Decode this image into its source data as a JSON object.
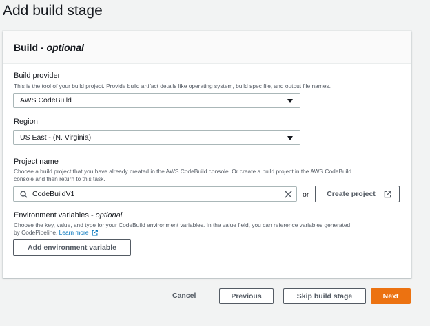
{
  "page": {
    "title": "Add build stage"
  },
  "panel": {
    "title": "Build",
    "title_suffix": "optional",
    "build_provider": {
      "label": "Build provider",
      "description": "This is the tool of your build project. Provide build artifact details like operating system, build spec file, and output file names.",
      "value": "AWS CodeBuild"
    },
    "region": {
      "label": "Region",
      "value": "US East - (N. Virginia)"
    },
    "project_name": {
      "label": "Project name",
      "description_line1": "Choose a build project that you have already created in the AWS CodeBuild console. Or create a build project in the AWS CodeBuild",
      "description_line2": "console and then return to this task.",
      "value": "CodeBuildV1",
      "or_text": "or",
      "create_button": "Create project"
    },
    "env_vars": {
      "label": "Environment variables",
      "label_suffix": "optional",
      "description_line1": "Choose the key, value, and type for your CodeBuild environment variables. In the value field, you can reference variables generated",
      "description_line2": "by CodePipeline.",
      "learn_more": "Learn more",
      "add_button": "Add environment variable"
    }
  },
  "footer": {
    "cancel": "Cancel",
    "previous": "Previous",
    "skip": "Skip build stage",
    "next": "Next"
  },
  "colors": {
    "primary": "#ec7211",
    "link": "#0073bb",
    "background": "#f2f3f3"
  },
  "icons": [
    "caret-down-icon",
    "search-icon",
    "close-icon",
    "external-link-icon"
  ]
}
